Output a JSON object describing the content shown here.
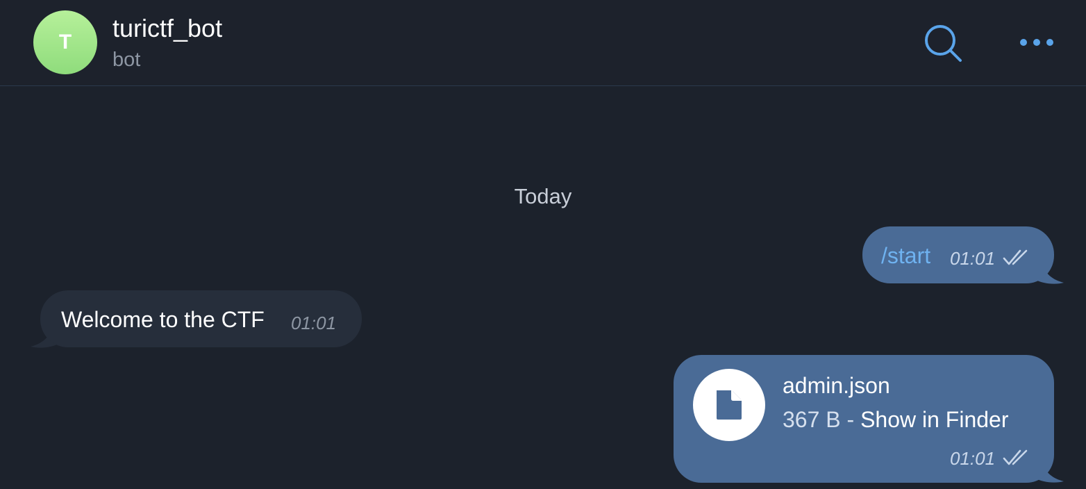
{
  "header": {
    "avatar_letter": "T",
    "title": "turictf_bot",
    "subtitle": "bot",
    "search_icon": "search-icon",
    "more_icon": "more-dots-icon"
  },
  "date_divider": "Today",
  "messages": [
    {
      "direction": "outgoing",
      "text": "/start",
      "time": "01:01",
      "status": "read"
    },
    {
      "direction": "incoming",
      "text": "Welcome to the CTF",
      "time": "01:01"
    },
    {
      "direction": "outgoing",
      "type": "file",
      "file_icon": "document-icon",
      "file_name": "admin.json",
      "file_size": "367 B",
      "separator": "-",
      "action_label": "Show in Finder",
      "time": "01:01",
      "status": "read"
    }
  ],
  "colors": {
    "background": "#1c222c",
    "outgoing_bubble": "#4a6b96",
    "incoming_bubble": "#262e3b",
    "accent": "#5aa4ea",
    "command_link": "#6fb2f0"
  }
}
